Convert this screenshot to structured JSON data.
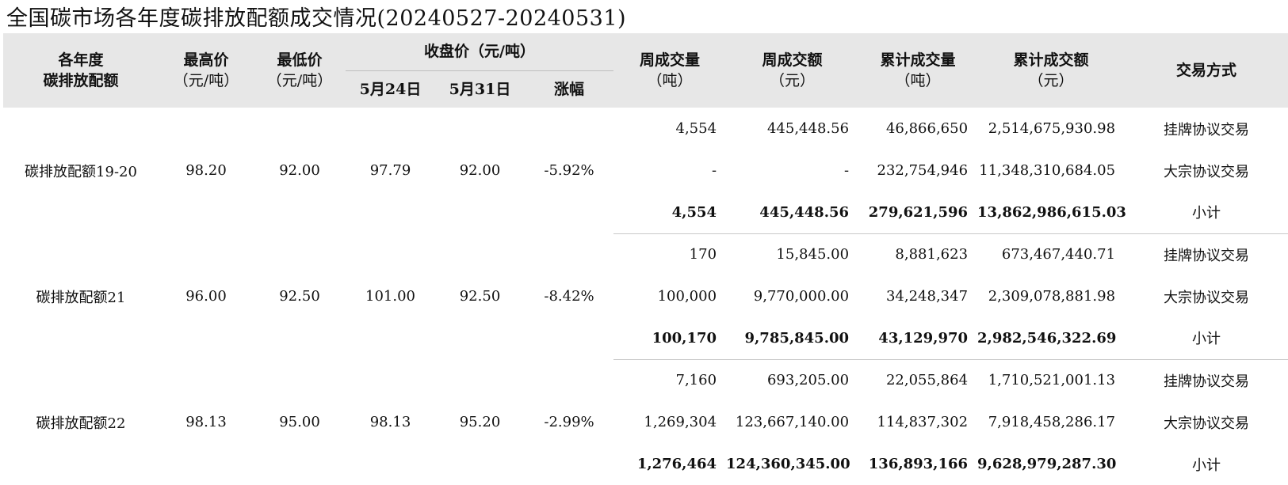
{
  "title": "全国碳市场各年度碳排放配额成交情况(20240527-20240531)",
  "header": {
    "allowance": [
      "各年度",
      "碳排放配额"
    ],
    "high": [
      "最高价",
      "（元/吨）"
    ],
    "low": [
      "最低价",
      "（元/吨）"
    ],
    "close": "收盘价（元/吨）",
    "close_prev": "5月24日",
    "close_cur": "5月31日",
    "change": "涨幅",
    "week_vol": [
      "周成交量",
      "（吨）"
    ],
    "week_amt": [
      "周成交额",
      "（元）"
    ],
    "cum_vol": [
      "累计成交量",
      "（吨）"
    ],
    "cum_amt": [
      "累计成交额",
      "（元）"
    ],
    "method": "交易方式"
  },
  "groups": [
    {
      "name": "碳排放配额19-20",
      "high": "98.20",
      "low": "92.00",
      "close_prev": "97.79",
      "close_cur": "92.00",
      "change": "-5.92%",
      "rows": [
        {
          "week_vol": "4,554",
          "week_amt": "445,448.56",
          "cum_vol": "46,866,650",
          "cum_amt": "2,514,675,930.98",
          "method": "挂牌协议交易"
        },
        {
          "week_vol": "-",
          "week_amt": "-",
          "cum_vol": "232,754,946",
          "cum_amt": "11,348,310,684.05",
          "method": "大宗协议交易"
        },
        {
          "week_vol": "4,554",
          "week_amt": "445,448.56",
          "cum_vol": "279,621,596",
          "cum_amt": "13,862,986,615.03",
          "method": "小计"
        }
      ]
    },
    {
      "name": "碳排放配额21",
      "high": "96.00",
      "low": "92.50",
      "close_prev": "101.00",
      "close_cur": "92.50",
      "change": "-8.42%",
      "rows": [
        {
          "week_vol": "170",
          "week_amt": "15,845.00",
          "cum_vol": "8,881,623",
          "cum_amt": "673,467,440.71",
          "method": "挂牌协议交易"
        },
        {
          "week_vol": "100,000",
          "week_amt": "9,770,000.00",
          "cum_vol": "34,248,347",
          "cum_amt": "2,309,078,881.98",
          "method": "大宗协议交易"
        },
        {
          "week_vol": "100,170",
          "week_amt": "9,785,845.00",
          "cum_vol": "43,129,970",
          "cum_amt": "2,982,546,322.69",
          "method": "小计"
        }
      ]
    },
    {
      "name": "碳排放配额22",
      "high": "98.13",
      "low": "95.00",
      "close_prev": "98.13",
      "close_cur": "95.20",
      "change": "-2.99%",
      "rows": [
        {
          "week_vol": "7,160",
          "week_amt": "693,205.00",
          "cum_vol": "22,055,864",
          "cum_amt": "1,710,521,001.13",
          "method": "挂牌协议交易"
        },
        {
          "week_vol": "1,269,304",
          "week_amt": "123,667,140.00",
          "cum_vol": "114,837,302",
          "cum_amt": "7,918,458,286.17",
          "method": "大宗协议交易"
        },
        {
          "week_vol": "1,276,464",
          "week_amt": "124,360,345.00",
          "cum_vol": "136,893,166",
          "cum_amt": "9,628,979,287.30",
          "method": "小计"
        }
      ]
    }
  ]
}
